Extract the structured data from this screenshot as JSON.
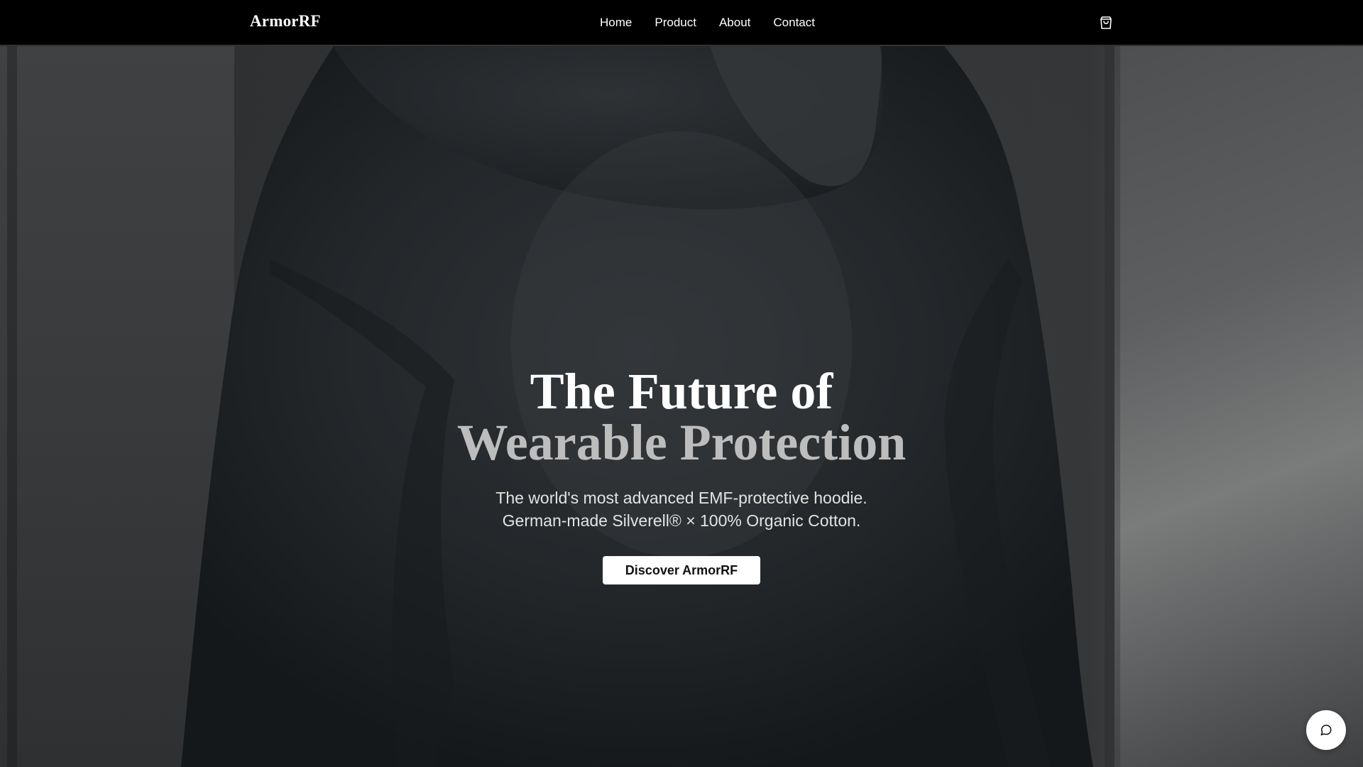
{
  "header": {
    "logo": "ArmorRF",
    "nav": [
      {
        "label": "Home"
      },
      {
        "label": "Product"
      },
      {
        "label": "About"
      },
      {
        "label": "Contact"
      }
    ],
    "cart_icon": "shopping-bag-icon"
  },
  "hero": {
    "headline_line1": "The Future of",
    "headline_line2": "Wearable Protection",
    "subtitle_line1": "The world's most advanced EMF-protective hoodie.",
    "subtitle_line2": "German-made Silverell® × 100% Organic Cotton.",
    "cta_label": "Discover ArmorRF"
  },
  "chat": {
    "icon": "chat-bubble-icon"
  },
  "colors": {
    "header_bg": "#000000",
    "headline_primary": "#ffffff",
    "headline_secondary": "#bdbdbd",
    "cta_bg": "#ffffff",
    "cta_text": "#111111"
  }
}
